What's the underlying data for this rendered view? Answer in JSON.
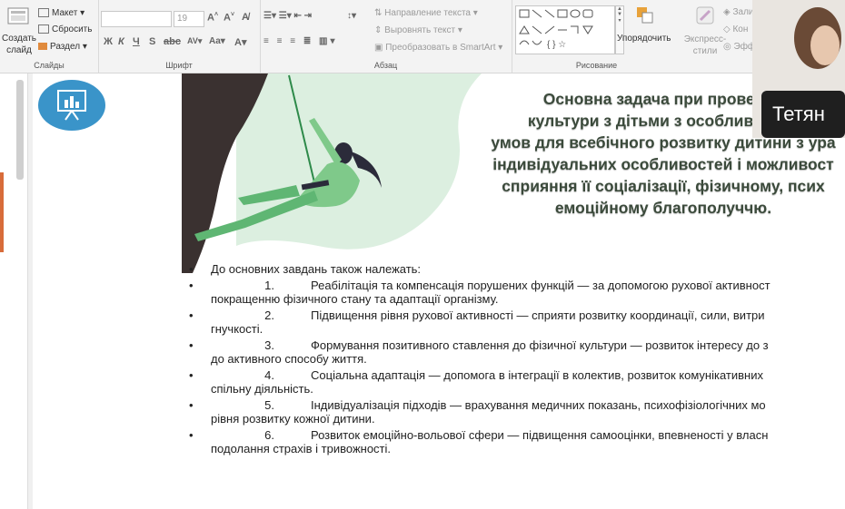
{
  "ribbon": {
    "slides_group": {
      "new_slide": "Создать слайд",
      "layout": "Макет",
      "reset": "Сбросить",
      "section": "Раздел",
      "label": "Слайды"
    },
    "font_group": {
      "font_size": "19",
      "label": "Шрифт"
    },
    "paragraph_group": {
      "text_direction": "Направление текста",
      "align_text": "Выровнять текст",
      "smartart": "Преобразовать в SmartArt",
      "label": "Абзац"
    },
    "drawing_group": {
      "arrange": "Упорядочить",
      "quick_styles": "Экспресс-стили",
      "fill": "Зали",
      "outline": "Кон",
      "effects": "Эфф",
      "label": "Рисование"
    }
  },
  "video": {
    "participant_name": "Тетян"
  },
  "slide": {
    "title_lines": [
      "Основна задача при проведен",
      "культури з дітьми з особливими п",
      "умов для всебічного розвитку дитини з ура",
      "індивідуальних особливостей і можливост",
      "сприяння її соціалізації, фізичному, псих",
      "емоційному благополуччю."
    ],
    "intro": "До основних завдань також належать:",
    "items": [
      {
        "num": "1.",
        "line1": "Реабілітація та компенсація порушених функцій — за допомогою рухової активност",
        "line2": "покращенню фізичного стану та адаптації організму."
      },
      {
        "num": "2.",
        "line1": "Підвищення рівня рухової активності — сприяти розвитку координації, сили, витри",
        "line2": "гнучкості."
      },
      {
        "num": "3.",
        "line1": "Формування позитивного ставлення до фізичної культури — розвиток інтересу до з",
        "line2": "до активного способу життя."
      },
      {
        "num": "4.",
        "line1": "Соціальна адаптація — допомога в інтеграції в колектив, розвиток комунікативних",
        "line2": "спільну діяльність."
      },
      {
        "num": "5.",
        "line1": "Індивідуалізація підходів — врахування медичних показань, психофізіологічних мо",
        "line2": "рівня розвитку кожної дитини."
      },
      {
        "num": "6.",
        "line1": "Розвиток емоційно-вольової сфери — підвищення самооцінки, впевненості у власн",
        "line2": "подолання страхів і тривожності."
      }
    ]
  }
}
